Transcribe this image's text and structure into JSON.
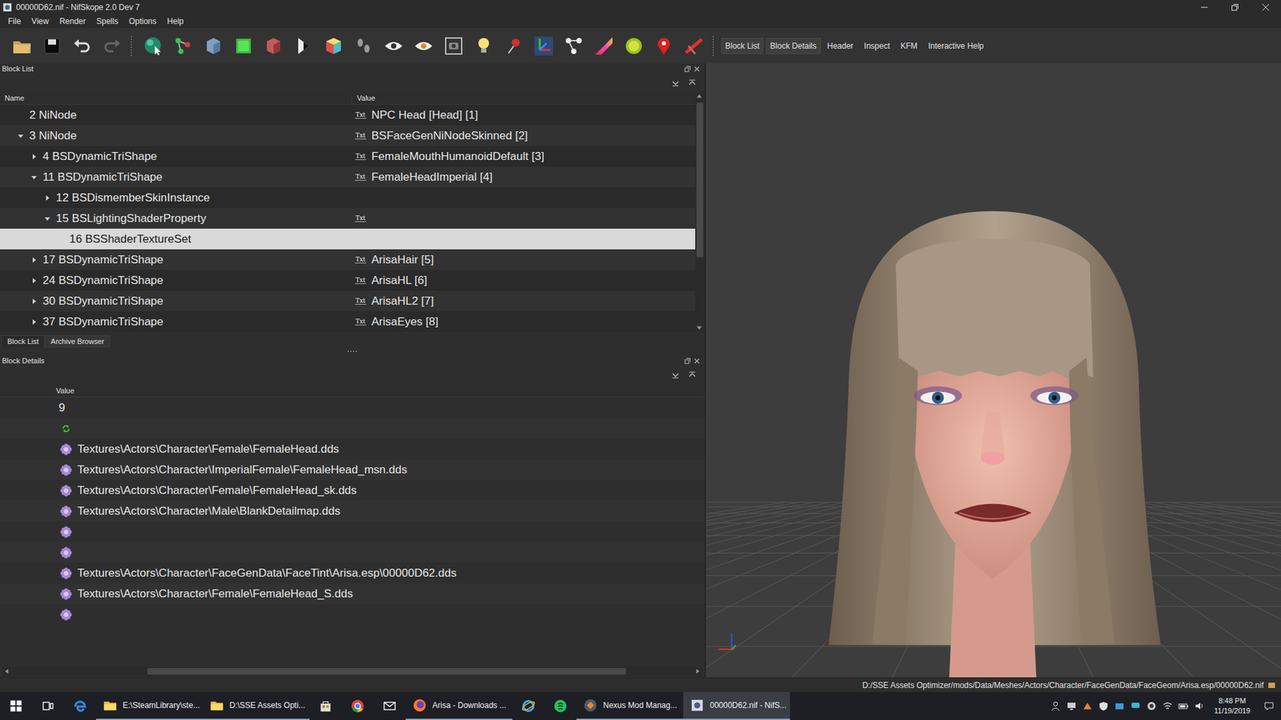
{
  "window": {
    "title": "00000D62.nif - NifSkope 2.0 Dev 7"
  },
  "menu": [
    "File",
    "View",
    "Render",
    "Spells",
    "Options",
    "Help"
  ],
  "toolbar": {
    "buttons": [
      {
        "label": "Block List",
        "checked": true
      },
      {
        "label": "Block Details",
        "checked": true
      },
      {
        "label": "Header",
        "checked": false
      },
      {
        "label": "Inspect",
        "checked": false
      },
      {
        "label": "KFM",
        "checked": false
      },
      {
        "label": "Interactive Help",
        "checked": false
      }
    ]
  },
  "block_list": {
    "title": "Block List",
    "columns": [
      "Name",
      "Value"
    ],
    "rows": [
      {
        "name": "2 NiNode",
        "value": "NPC Head [Head] [1]",
        "value_icon": "Txt",
        "depth": 0,
        "expandable": false,
        "expanded": false,
        "selected": false
      },
      {
        "name": "3 NiNode",
        "value": "BSFaceGenNiNodeSkinned [2]",
        "value_icon": "Txt",
        "depth": 0,
        "expandable": true,
        "expanded": true,
        "selected": false
      },
      {
        "name": "4 BSDynamicTriShape",
        "value": "FemaleMouthHumanoidDefault [3]",
        "value_icon": "Txt",
        "depth": 1,
        "expandable": true,
        "expanded": false,
        "selected": false
      },
      {
        "name": "11 BSDynamicTriShape",
        "value": "FemaleHeadImperial [4]",
        "value_icon": "Txt",
        "depth": 1,
        "expandable": true,
        "expanded": true,
        "selected": false
      },
      {
        "name": "12 BSDismemberSkinInstance",
        "value": "",
        "value_icon": "",
        "depth": 2,
        "expandable": true,
        "expanded": false,
        "selected": false
      },
      {
        "name": "15 BSLightingShaderProperty",
        "value": "",
        "value_icon": "Txt",
        "depth": 2,
        "expandable": true,
        "expanded": true,
        "selected": false
      },
      {
        "name": "16 BSShaderTextureSet",
        "value": "",
        "value_icon": "",
        "depth": 3,
        "expandable": false,
        "expanded": false,
        "selected": true
      },
      {
        "name": "17 BSDynamicTriShape",
        "value": "ArisaHair [5]",
        "value_icon": "Txt",
        "depth": 1,
        "expandable": true,
        "expanded": false,
        "selected": false
      },
      {
        "name": "24 BSDynamicTriShape",
        "value": "ArisaHL [6]",
        "value_icon": "Txt",
        "depth": 1,
        "expandable": true,
        "expanded": false,
        "selected": false
      },
      {
        "name": "30 BSDynamicTriShape",
        "value": "ArisaHL2 [7]",
        "value_icon": "Txt",
        "depth": 1,
        "expandable": true,
        "expanded": false,
        "selected": false
      },
      {
        "name": "37 BSDynamicTriShape",
        "value": "ArisaEyes [8]",
        "value_icon": "Txt",
        "depth": 1,
        "expandable": true,
        "expanded": false,
        "selected": false
      }
    ]
  },
  "tabs": [
    {
      "label": "Block List",
      "selected": true
    },
    {
      "label": "Archive Browser",
      "selected": false
    }
  ],
  "block_details": {
    "title": "Block Details",
    "columns": [
      "Value"
    ],
    "rows": [
      {
        "kind": "number",
        "value": "9"
      },
      {
        "kind": "link",
        "value": ""
      },
      {
        "kind": "texture",
        "value": "Textures\\Actors\\Character\\Female\\FemaleHead.dds"
      },
      {
        "kind": "texture",
        "value": "Textures\\Actors\\Character\\ImperialFemale\\FemaleHead_msn.dds"
      },
      {
        "kind": "texture",
        "value": "Textures\\Actors\\Character\\Female\\FemaleHead_sk.dds"
      },
      {
        "kind": "texture",
        "value": "Textures\\Actors\\Character\\Male\\BlankDetailmap.dds"
      },
      {
        "kind": "texture",
        "value": ""
      },
      {
        "kind": "texture",
        "value": ""
      },
      {
        "kind": "texture",
        "value": "Textures\\Actors\\Character\\FaceGenData\\FaceTint\\Arisa.esp\\00000D62.dds"
      },
      {
        "kind": "texture",
        "value": "Textures\\Actors\\Character\\Female\\FemaleHead_S.dds"
      },
      {
        "kind": "texture",
        "value": ""
      }
    ]
  },
  "status_bar": {
    "path": "D:/SSE Assets Optimizer/mods/Data/Meshes/Actors/Character/FaceGenData/FaceGeom/Arisa.esp/00000D62.nif"
  },
  "taskbar": {
    "items": [
      {
        "kind": "start",
        "label": "",
        "selected": false
      },
      {
        "kind": "taskview",
        "label": "",
        "selected": false
      },
      {
        "kind": "edge",
        "label": "",
        "selected": false
      },
      {
        "kind": "explorer",
        "label": "E:\\SteamLibrary\\ste...",
        "selected": false
      },
      {
        "kind": "explorer",
        "label": "D:\\SSE Assets Opti...",
        "selected": false
      },
      {
        "kind": "store",
        "label": "",
        "selected": false
      },
      {
        "kind": "chrome",
        "label": "",
        "selected": false
      },
      {
        "kind": "mail",
        "label": "",
        "selected": false
      },
      {
        "kind": "firefox",
        "label": "Arisa - Downloads ...",
        "selected": false
      },
      {
        "kind": "ie",
        "label": "",
        "selected": false
      },
      {
        "kind": "greenapp",
        "label": "",
        "selected": false
      },
      {
        "kind": "nexus",
        "label": "Nexus Mod Manag...",
        "selected": false
      },
      {
        "kind": "nifskope",
        "label": "00000D62.nif - NifS...",
        "selected": true
      }
    ],
    "time": "8:48 PM",
    "date": "11/19/2019"
  }
}
